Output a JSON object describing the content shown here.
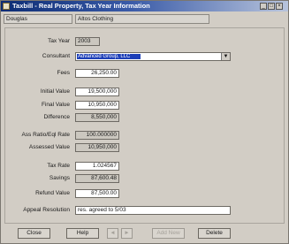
{
  "window": {
    "title": "Taxbill - Real Property, Tax Year Information",
    "icon": "window-app-icon",
    "controls": {
      "minimize": "_",
      "maximize": "□",
      "close": "×"
    }
  },
  "header": {
    "county": "Douglas",
    "property": "Altos Clothing"
  },
  "form": {
    "tax_year": {
      "label": "Tax Year",
      "value": "2003"
    },
    "consultant": {
      "label": "Consultant",
      "value": "Advanced Group, LLC",
      "dropdown_icon": "chevron-down-icon"
    },
    "fees": {
      "label": "Fees",
      "value": "26,250.00"
    },
    "initial_value": {
      "label": "Initial Value",
      "value": "19,500,000"
    },
    "final_value": {
      "label": "Final Value",
      "value": "10,950,000"
    },
    "difference": {
      "label": "Difference",
      "value": "8,550,000"
    },
    "ratio": {
      "label": "Ass Ratio/Eql Rate",
      "value": "100.000000"
    },
    "assessed_value": {
      "label": "Assessed Value",
      "value": "10,950,000"
    },
    "tax_rate": {
      "label": "Tax Rate",
      "value": "1.024567"
    },
    "savings": {
      "label": "Savings",
      "value": "87,600.48"
    },
    "refund_value": {
      "label": "Refund Value",
      "value": "87,500.00"
    },
    "appeal_resolution": {
      "label": "Appeal Resolution",
      "value": "res. agreed to 5/03"
    }
  },
  "toolbar": {
    "close": "Close",
    "help": "Help",
    "prev_icon": "arrow-left-icon",
    "next_icon": "arrow-right-icon",
    "prev_glyph": "◄",
    "next_glyph": "►",
    "add_new": "Add New",
    "delete": "Delete"
  }
}
